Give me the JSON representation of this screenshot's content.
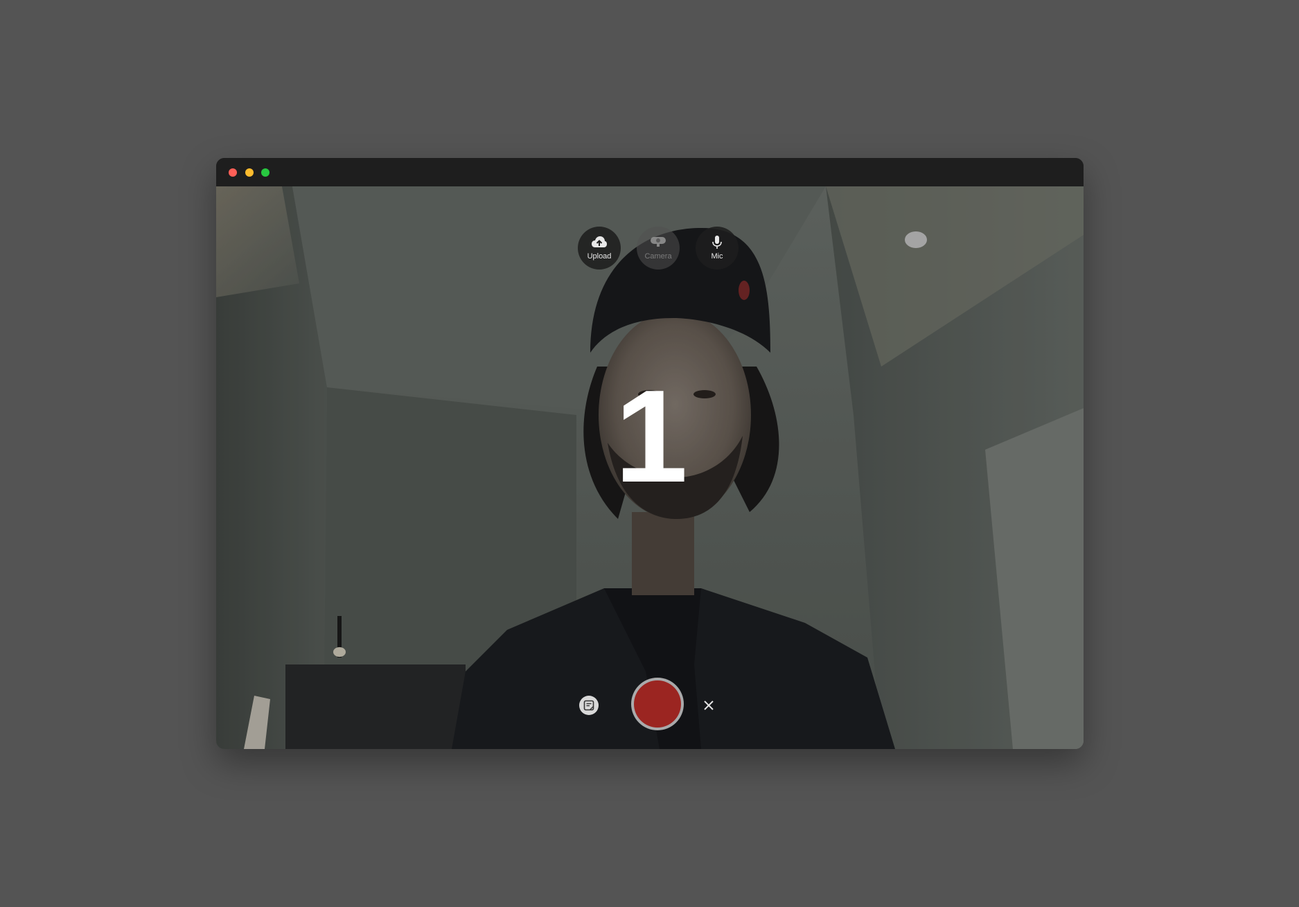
{
  "window": {
    "traffic_lights": [
      "close",
      "minimize",
      "zoom"
    ]
  },
  "top_controls": {
    "upload": {
      "label": "Upload",
      "icon": "cloud-upload-icon",
      "enabled": true
    },
    "camera": {
      "label": "Camera",
      "icon": "webcam-icon",
      "enabled": false
    },
    "mic": {
      "label": "Mic",
      "icon": "microphone-icon",
      "enabled": true
    }
  },
  "countdown": {
    "value": "1"
  },
  "bottom_controls": {
    "notes_icon": "notes-icon",
    "record_icon": "record-icon",
    "close_icon": "close-icon"
  },
  "colors": {
    "background": "#545454",
    "titlebar": "#1e1e1e",
    "record": "#9b2521",
    "close_light": "#ff5f57",
    "minimize_light": "#febc2e",
    "zoom_light": "#28c840"
  }
}
